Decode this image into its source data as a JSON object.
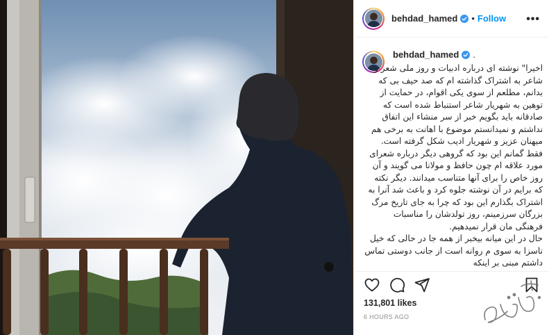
{
  "post": {
    "username": "behdad_hamed",
    "follow_label": "Follow",
    "separator": "•",
    "more_label": "•••",
    "caption_dot": ".",
    "caption": "اخیرا\" نوشته ای درباره ادبیات و روز ملی شعر و شاعر به اشتراک گذاشته ام که صد حیف بی که بدانم، مطلعم از سوی یکی اقوام، در حمایت از توهین به شهریار شاعر استنباط شده است که صادقانه باید بگویم خبر از سر منشاء این اتفاق نداشتم و نمیدانستم موضوع با اهانت به برخی هم میهنان عزیز و شهریار ادیب شکل گرفته است. فقط گمانم این بود که گروهی دیگر درباره شعرای مورد علاقه ام چون حافظ و مولانا می گویند و آن روز خاص را برای آنها متناسب میدانند. دیگر نکته که برایم در آن نوشته جلوه کرد و باعث شد آنرا به اشتراک بگذارم این بود که چرا به جای تاریخ مرگ بزرگان سرزمینم، روز تولدشان را مناسبات فرهنگی مان قرار نمیدهیم.\nحال در این میانه بیخبر از همه جا در حالی که خیل ناسزا به سوی م روانه است از جانب دوستی تماس داشتم مبنی بر اینکه",
    "likes": "131,801 likes",
    "timestamp": "6 HOURS AGO"
  },
  "icons": {
    "like": "heart-icon",
    "comment": "comment-icon",
    "share": "share-icon",
    "save": "bookmark-icon",
    "verified": "verified-badge-icon"
  },
  "colors": {
    "follow": "#0095f6",
    "verified": "#3897f0",
    "text": "#262626",
    "muted": "#8e8e8e",
    "border": "#efefef"
  }
}
